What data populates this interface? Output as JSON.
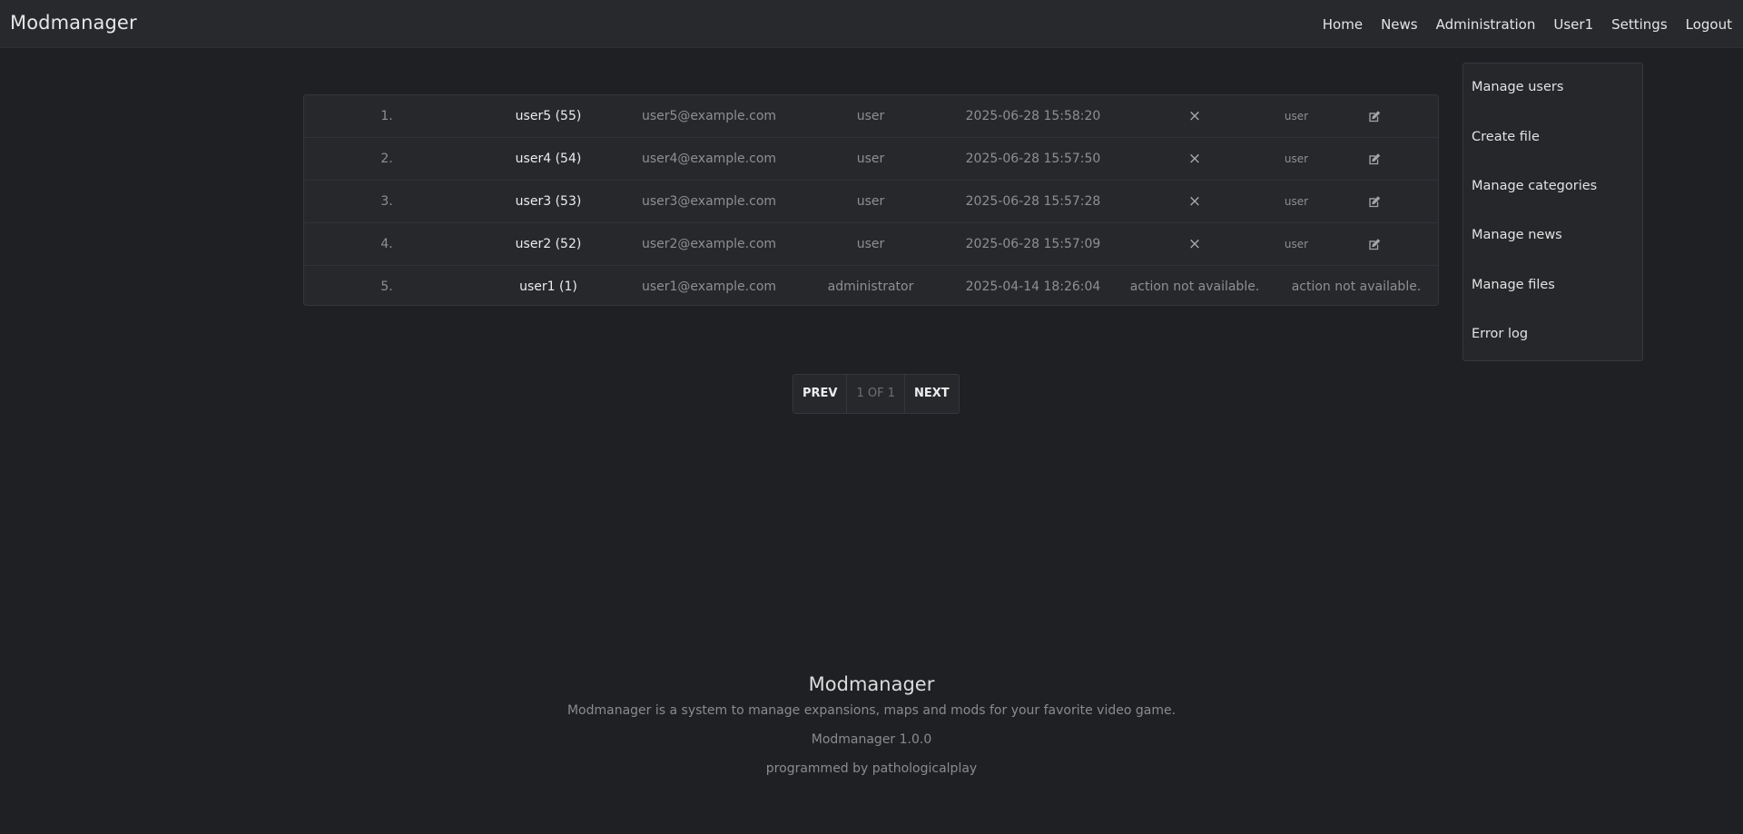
{
  "header": {
    "brand": "Modmanager",
    "nav": [
      "Home",
      "News",
      "Administration",
      "User1",
      "Settings",
      "Logout"
    ]
  },
  "users": [
    {
      "num": "1.",
      "name": "user5 (55)",
      "email": "user5@example.com",
      "role": "user",
      "date": "2025-06-28 15:58:20",
      "action": "×",
      "level": "user",
      "editable": true
    },
    {
      "num": "2.",
      "name": "user4 (54)",
      "email": "user4@example.com",
      "role": "user",
      "date": "2025-06-28 15:57:50",
      "action": "×",
      "level": "user",
      "editable": true
    },
    {
      "num": "3.",
      "name": "user3 (53)",
      "email": "user3@example.com",
      "role": "user",
      "date": "2025-06-28 15:57:28",
      "action": "×",
      "level": "user",
      "editable": true
    },
    {
      "num": "4.",
      "name": "user2 (52)",
      "email": "user2@example.com",
      "role": "user",
      "date": "2025-06-28 15:57:09",
      "action": "×",
      "level": "user",
      "editable": true
    },
    {
      "num": "5.",
      "name": "user1 (1)",
      "email": "user1@example.com",
      "role": "administrator",
      "date": "2025-04-14 18:26:04",
      "action": "action not available.",
      "level": "action not available.",
      "editable": false
    }
  ],
  "admin_menu": [
    "Manage users",
    "Create file",
    "Manage categories",
    "Manage news",
    "Manage files",
    "Error log"
  ],
  "pagination": {
    "prev": "PREV",
    "info": "1 OF 1",
    "next": "NEXT"
  },
  "footer": {
    "title": "Modmanager",
    "description": "Modmanager is a system to manage expansions, maps and mods for your favorite video game.",
    "version": "Modmanager 1.0.0",
    "credit": "programmed by pathologicalplay"
  },
  "icons": {
    "delete": "close-icon",
    "edit": "edit-icon"
  }
}
